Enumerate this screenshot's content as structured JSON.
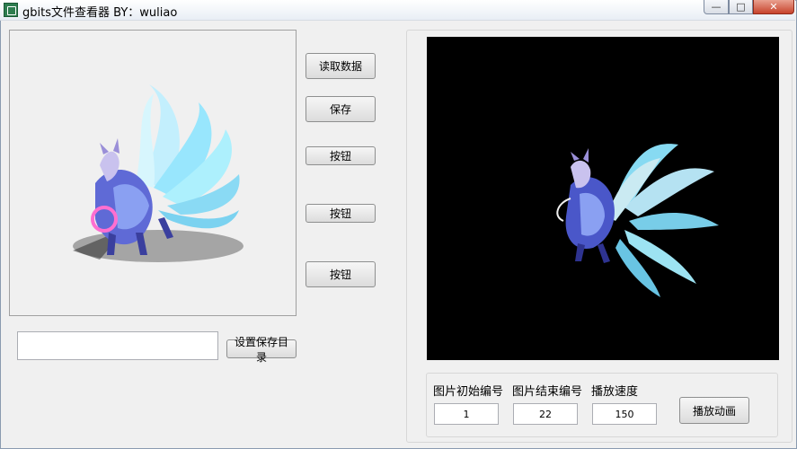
{
  "window": {
    "title": "gbits文件查看器 BY：wuliao",
    "controls": {
      "minimize": "—",
      "maximize": "□",
      "close": "✕"
    }
  },
  "toolbar": {
    "read_data_label": "读取数据",
    "save_label": "保存",
    "button1_label": "按钮",
    "button2_label": "按钮",
    "button3_label": "按钮"
  },
  "save_dir": {
    "path_value": "",
    "button_label": "设置保存目录"
  },
  "animation": {
    "start_label": "图片初始编号",
    "start_value": "1",
    "end_label": "图片结束编号",
    "end_value": "22",
    "speed_label": "播放速度",
    "speed_value": "150",
    "play_label": "播放动画"
  },
  "colors": {
    "preview_background": "#000000",
    "creature_primary": "#8fe6ff",
    "creature_secondary": "#4a57c9"
  },
  "icons": {
    "app": "app-icon",
    "creature": "nine-tailed-fox-sprite"
  }
}
